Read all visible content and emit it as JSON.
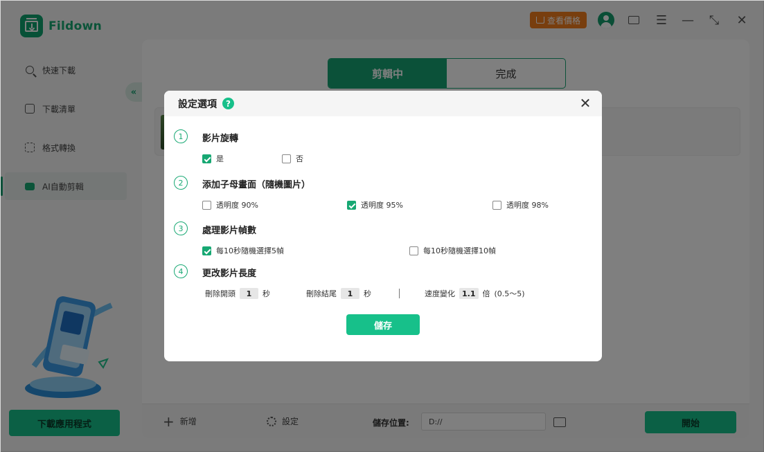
{
  "app": {
    "name": "Fildown",
    "price_button": "查看價格"
  },
  "sidebar": {
    "items": [
      {
        "label": "快速下載",
        "icon": "search-icon"
      },
      {
        "label": "下載清單",
        "icon": "download-list-icon"
      },
      {
        "label": "格式轉換",
        "icon": "format-convert-icon"
      },
      {
        "label": "AI自動剪輯",
        "icon": "ai-edit-icon",
        "active": true
      }
    ],
    "download_app_button": "下載應用程式"
  },
  "main": {
    "tabs": [
      {
        "label": "剪輯中",
        "active": true
      },
      {
        "label": "完成",
        "active": false
      }
    ]
  },
  "footer": {
    "add_label": "新增",
    "settings_label": "設定",
    "save_location_label": "儲存位置:",
    "save_path": "D://",
    "start_button": "開始"
  },
  "dialog": {
    "title": "設定選項",
    "sections": [
      {
        "number": "1",
        "title": "影片旋轉",
        "options": [
          {
            "label": "是",
            "checked": true
          },
          {
            "label": "否",
            "checked": false
          }
        ]
      },
      {
        "number": "2",
        "title": "添加子母畫面（隨機圖片）",
        "options": [
          {
            "label": "透明度 90%",
            "checked": false
          },
          {
            "label": "透明度 95%",
            "checked": true
          },
          {
            "label": "透明度 98%",
            "checked": false
          }
        ]
      },
      {
        "number": "3",
        "title": "處理影片幀數",
        "options": [
          {
            "label": "每10秒隨機選擇5幀",
            "checked": true
          },
          {
            "label": "每10秒隨機選擇10幀",
            "checked": false
          }
        ]
      },
      {
        "number": "4",
        "title": "更改影片長度",
        "trim_start_label": "刪除開頭",
        "trim_start_value": "1",
        "trim_end_label": "刪除結尾",
        "trim_end_value": "1",
        "seconds_unit": "秒",
        "speed_label": "速度變化",
        "speed_value": "1.1",
        "speed_unit": "倍",
        "speed_range": "(0.5〜5)"
      }
    ],
    "save_button": "儲存"
  }
}
